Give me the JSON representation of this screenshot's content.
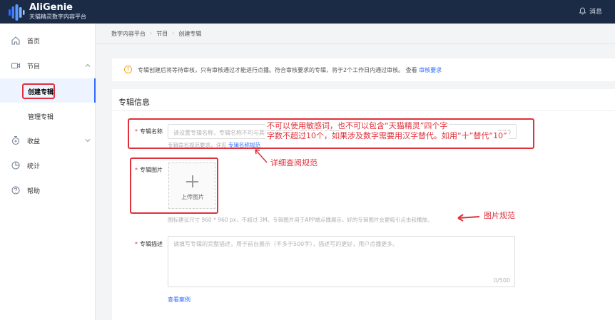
{
  "header": {
    "brand_name": "AliGenie",
    "brand_sub": "天猫精灵数字内容平台",
    "message_label": "消息"
  },
  "sidebar": {
    "items": [
      {
        "label": "首页",
        "icon": "home-icon"
      },
      {
        "label": "节目",
        "icon": "video-icon",
        "expanded": true
      },
      {
        "label": "创建专辑",
        "active": true
      },
      {
        "label": "管理专辑"
      },
      {
        "label": "收益",
        "icon": "coin-icon",
        "collapsed": true
      },
      {
        "label": "统计",
        "icon": "pie-chart-icon"
      },
      {
        "label": "帮助",
        "icon": "help-icon"
      }
    ]
  },
  "breadcrumb": [
    "数字内容平台",
    "节目",
    "创建专辑"
  ],
  "notice": {
    "text": "专辑创建后将等待审核，只有审核通过才能进行点播。符合审核要求的专辑，将于2个工作日内通过审核。 查看",
    "link": "审核要求"
  },
  "form": {
    "section_title": "专辑信息",
    "name": {
      "label": "专辑名称",
      "placeholder": "请设置专辑名称，专辑名称不可与其他专辑重复，不超过10个字符",
      "counter": "0/10",
      "hint": "专辑命名规范要求，详见",
      "hint_link": "专辑名称规范"
    },
    "image": {
      "label": "专辑图片",
      "upload_label": "上传图片",
      "hint": "图标建议尺寸 960 * 960 px，不超过 3M。专辑图片用于APP端点播展示，好的专辑图片会更吸引点击和播放。"
    },
    "desc": {
      "label": "专辑描述",
      "placeholder": "请填写专辑的完整描述，用于前台展示（不多于500字），描述写的更好，用户点播更多。",
      "counter": "0/500"
    },
    "case_link": "查看案例"
  },
  "annotations": {
    "name_rule_line1": "不可以使用敏感词，也不可以包含“天猫精灵”四个字",
    "name_rule_line2": "字数不超过10个，如果涉及数字需要用汉字替代。如用“十”替代“10”",
    "detail_rule": "详细查阅规范",
    "image_rule": "图片规范"
  },
  "colors": {
    "topbar": "#1c2b45",
    "accent": "#2f6bff",
    "annotation": "#e0303a"
  }
}
